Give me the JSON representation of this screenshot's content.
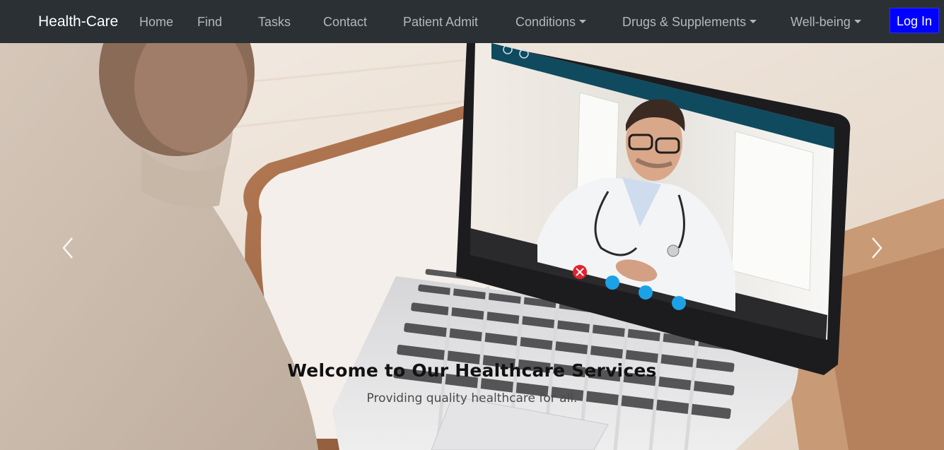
{
  "navbar": {
    "brand": "Health-Care",
    "items": [
      {
        "label": "Home",
        "dropdown": false
      },
      {
        "label": "Find",
        "dropdown": false
      },
      {
        "label": "Tasks",
        "dropdown": false
      },
      {
        "label": "Contact",
        "dropdown": false
      },
      {
        "label": "Patient Admit",
        "dropdown": false
      },
      {
        "label": "Conditions",
        "dropdown": true
      },
      {
        "label": "Drugs & Supplements",
        "dropdown": true
      },
      {
        "label": "Well-being",
        "dropdown": true
      }
    ],
    "login_label": "Log In"
  },
  "carousel": {
    "title": "Welcome to Our Healthcare Services",
    "subtitle": "Providing quality healthcare for all.",
    "prev_icon": "chevron-left-icon",
    "next_icon": "chevron-right-icon"
  },
  "colors": {
    "navbar_bg": "#2b3035",
    "login_bg": "#0000ff",
    "nav_text": "#b4b7ba"
  }
}
